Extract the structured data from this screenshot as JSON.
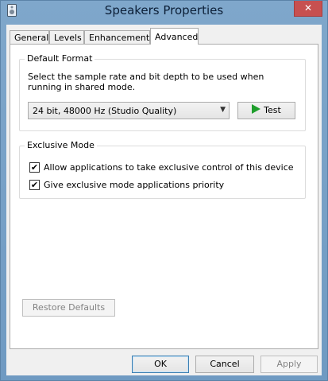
{
  "window": {
    "title": "Speakers Properties",
    "close_glyph": "✕"
  },
  "tabs": [
    {
      "label": "General",
      "active": false
    },
    {
      "label": "Levels",
      "active": false
    },
    {
      "label": "Enhancements",
      "active": false
    },
    {
      "label": "Advanced",
      "active": true
    }
  ],
  "default_format": {
    "group_title": "Default Format",
    "description": "Select the sample rate and bit depth to be used when running in shared mode.",
    "selected_format": "24 bit, 48000 Hz (Studio Quality)",
    "test_button_label": "Test"
  },
  "exclusive_mode": {
    "group_title": "Exclusive Mode",
    "options": [
      {
        "label": "Allow applications to take exclusive control of this device",
        "checked": true
      },
      {
        "label": "Give exclusive mode applications priority",
        "checked": true
      }
    ]
  },
  "restore_defaults_label": "Restore Defaults",
  "footer": {
    "ok_label": "OK",
    "cancel_label": "Cancel",
    "apply_label": "Apply"
  },
  "icons": {
    "check_glyph": "✔",
    "dropdown_glyph": "▼"
  },
  "colors": {
    "titlebar": "#7fa7cb",
    "close_button": "#c75050",
    "play_icon": "#1f9e2c"
  }
}
